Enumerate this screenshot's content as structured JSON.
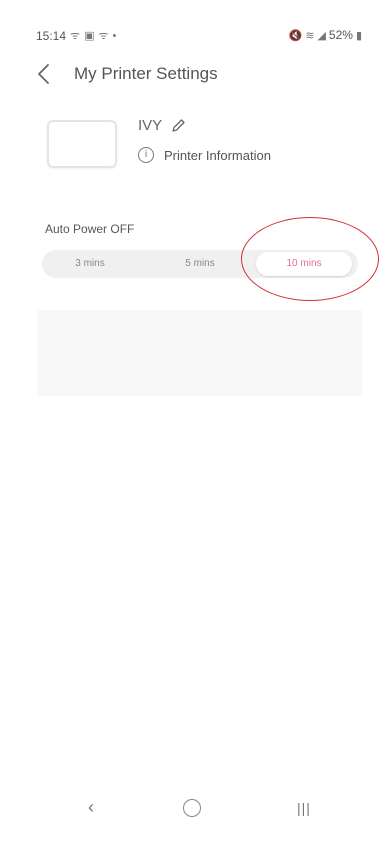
{
  "status_bar": {
    "time": "15:14",
    "left_icons": [
      "notification-icon",
      "gallery-icon",
      "notification-icon",
      "dot-icon"
    ],
    "battery": "52%",
    "right_icons": [
      "mute-icon",
      "wifi-icon",
      "signal-icon",
      "battery-icon"
    ]
  },
  "header": {
    "title": "My Printer Settings",
    "back_icon": "chevron-left-icon"
  },
  "printer": {
    "name": "IVY",
    "info_label": "Printer Information"
  },
  "auto_power": {
    "label": "Auto Power OFF",
    "options": [
      "3 mins",
      "5 mins",
      "10 mins"
    ],
    "selected": "10 mins"
  },
  "colors": {
    "accent": "#e56a98",
    "annotation": "#d62f3a",
    "segment_bg": "#f0f0f0"
  },
  "nav_bar": {
    "buttons": [
      "back-icon",
      "home-icon",
      "recent-apps-icon"
    ]
  }
}
